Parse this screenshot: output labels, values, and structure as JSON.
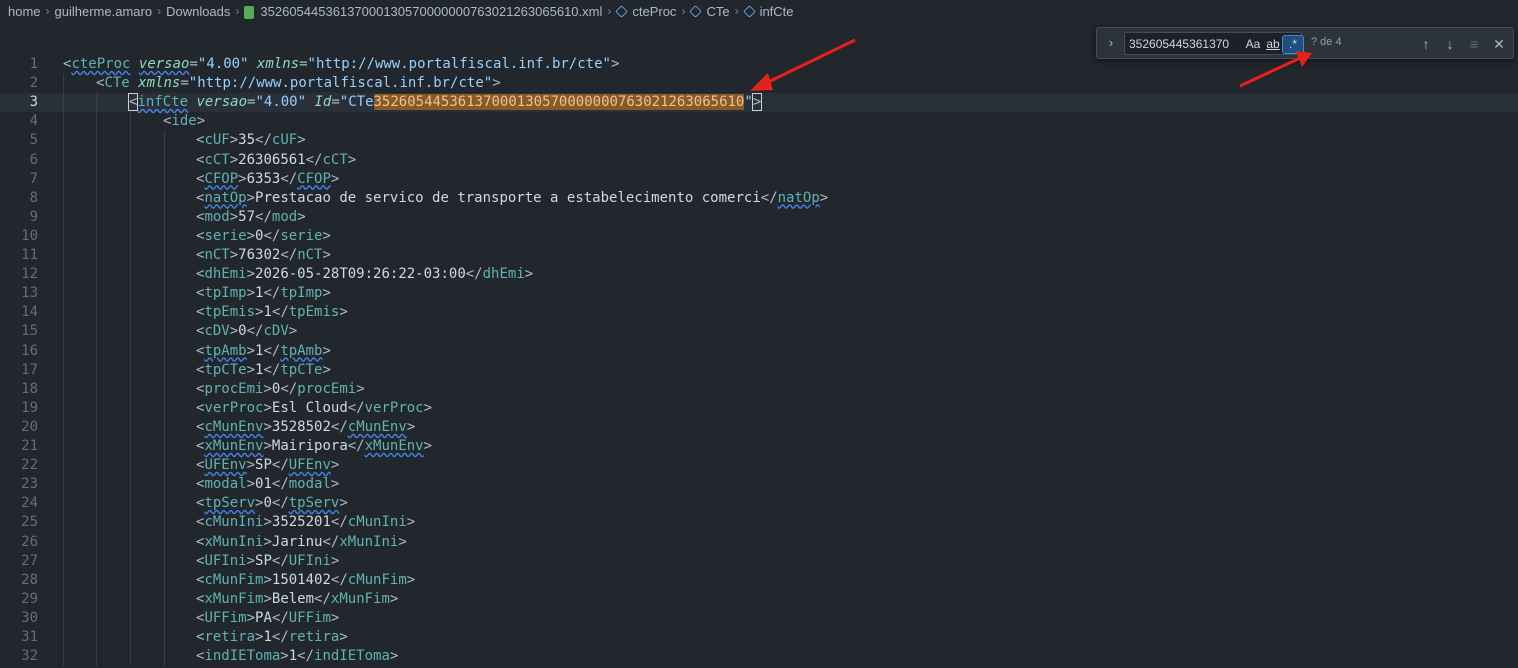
{
  "breadcrumb": {
    "home": "home",
    "user": "guilherme.amaro",
    "folder": "Downloads",
    "file": "35260544536137000130570000000763021263065610.xml",
    "sym1": "cteProc",
    "sym2": "CTe",
    "sym3": "infCte"
  },
  "find": {
    "value": "352605445361370",
    "match_case": "Aa",
    "whole_word": "ab",
    "regex": ".*",
    "count": "? de 4",
    "icons": [
      "chevron-right-icon",
      "arrow-up-icon",
      "arrow-down-icon",
      "selection-icon",
      "close-icon"
    ]
  },
  "colors": {
    "highlight": "#8a5a24",
    "annotation_arrow": "#e8201c",
    "tag": "#5fb3b3"
  },
  "lines": [
    {
      "n": "1",
      "t": "<cteProc versao=\"4.00\" xmlns=\"http://www.portalfiscal.inf.br/cte\">"
    },
    {
      "n": "2",
      "t": "<CTe xmlns=\"http://www.portalfiscal.inf.br/cte\">"
    },
    {
      "n": "3",
      "t": "<infCte versao=\"4.00\" Id=\"CTe35260544536137000130570000000763021263065610\">"
    },
    {
      "n": "4",
      "t": "<ide>"
    },
    {
      "n": "5",
      "t": "<cUF>35</cUF>"
    },
    {
      "n": "6",
      "t": "<cCT>26306561</cCT>"
    },
    {
      "n": "7",
      "t": "<CFOP>6353</CFOP>"
    },
    {
      "n": "8",
      "t": "<natOp>Prestacao de servico de transporte a estabelecimento comerci</natOp>"
    },
    {
      "n": "9",
      "t": "<mod>57</mod>"
    },
    {
      "n": "10",
      "t": "<serie>0</serie>"
    },
    {
      "n": "11",
      "t": "<nCT>76302</nCT>"
    },
    {
      "n": "12",
      "t": "<dhEmi>2026-05-28T09:26:22-03:00</dhEmi>"
    },
    {
      "n": "13",
      "t": "<tpImp>1</tpImp>"
    },
    {
      "n": "14",
      "t": "<tpEmis>1</tpEmis>"
    },
    {
      "n": "15",
      "t": "<cDV>0</cDV>"
    },
    {
      "n": "16",
      "t": "<tpAmb>1</tpAmb>"
    },
    {
      "n": "17",
      "t": "<tpCTe>1</tpCTe>"
    },
    {
      "n": "18",
      "t": "<procEmi>0</procEmi>"
    },
    {
      "n": "19",
      "t": "<verProc>Esl Cloud</verProc>"
    },
    {
      "n": "20",
      "t": "<cMunEnv>3528502</cMunEnv>"
    },
    {
      "n": "21",
      "t": "<xMunEnv>Mairipora</xMunEnv>"
    },
    {
      "n": "22",
      "t": "<UFEnv>SP</UFEnv>"
    },
    {
      "n": "23",
      "t": "<modal>01</modal>"
    },
    {
      "n": "24",
      "t": "<tpServ>0</tpServ>"
    },
    {
      "n": "25",
      "t": "<cMunIni>3525201</cMunIni>"
    },
    {
      "n": "26",
      "t": "<xMunIni>Jarinu</xMunIni>"
    },
    {
      "n": "27",
      "t": "<UFIni>SP</UFIni>"
    },
    {
      "n": "28",
      "t": "<cMunFim>1501402</cMunFim>"
    },
    {
      "n": "29",
      "t": "<xMunFim>Belem</xMunFim>"
    },
    {
      "n": "30",
      "t": "<UFFim>PA</UFFim>"
    },
    {
      "n": "31",
      "t": "<retira>1</retira>"
    },
    {
      "n": "32",
      "t": "<indIEToma>1</indIEToma>"
    }
  ]
}
